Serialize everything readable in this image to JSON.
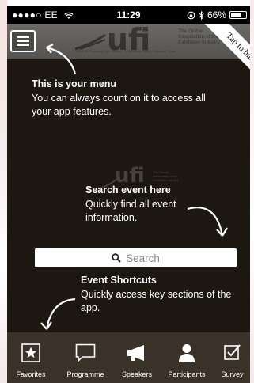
{
  "status_bar": {
    "carrier": "●●●●○ EE",
    "time": "11:29",
    "battery": "66%",
    "battery_level": 0.66
  },
  "header": {
    "logo_text": "ufi",
    "logo_tagline": "The Global Association of the Exhibition Industry",
    "logo_subline": "83rd UFI Congress | 29 October - 1 November 2016 | Shanghai, China",
    "tap_to_hide": "Tap to hide"
  },
  "tips": {
    "menu_title": "This is your menu",
    "menu_text": "You can always count on it to access all your app features.",
    "search_title": "Search event here",
    "search_text": "Quickly find all event information.",
    "shortcuts_title": "Event Shortcuts",
    "shortcuts_text": "Quickly access key sections of the app."
  },
  "background_logo": {
    "text": "ufi",
    "tagline": "The Global Association of the Exhibition Industry"
  },
  "search": {
    "placeholder": "Search",
    "icon": "search-icon"
  },
  "tabs": [
    {
      "label": "Favorites",
      "icon": "star-box-icon"
    },
    {
      "label": "Programme",
      "icon": "speech-bubble-icon"
    },
    {
      "label": "Speakers",
      "icon": "megaphone-icon"
    },
    {
      "label": "Participants",
      "icon": "person-icon"
    },
    {
      "label": "Survey",
      "icon": "checkbox-icon"
    }
  ],
  "colors": {
    "background": "#1d1712",
    "tabbar": "#3a3228",
    "text": "#ffffff",
    "header": "#5f5d59"
  }
}
